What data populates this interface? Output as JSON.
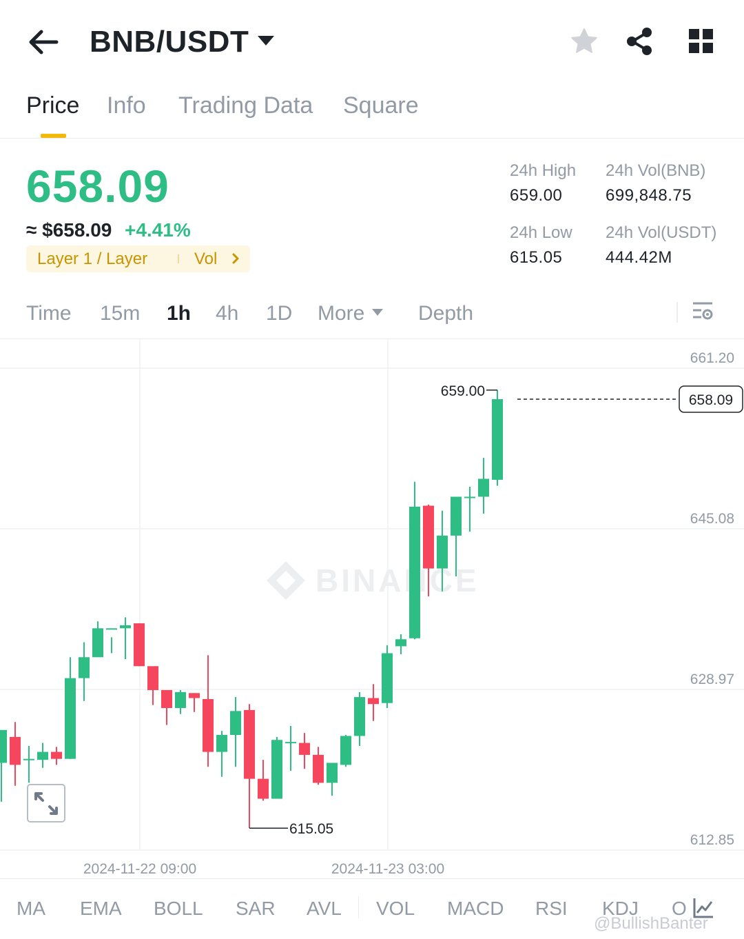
{
  "header": {
    "pair": "BNB/USDT",
    "icons": [
      "back-arrow-icon",
      "caret-down-icon",
      "star-icon",
      "share-icon",
      "grid-icon"
    ]
  },
  "tabs": [
    "Price",
    "Info",
    "Trading Data",
    "Square"
  ],
  "active_tab": "Price",
  "price": {
    "last": "658.09",
    "fiat": "≈ $658.09",
    "change": "+4.41%",
    "tag_category": "Layer 1 / Layer",
    "tag_vol": "Vol"
  },
  "stats": {
    "high_label": "24h High",
    "high_value": "659.00",
    "low_label": "24h Low",
    "low_value": "615.05",
    "vol_base_label": "24h Vol(BNB)",
    "vol_base_value": "699,848.75",
    "vol_quote_label": "24h Vol(USDT)",
    "vol_quote_value": "444.42M"
  },
  "intervals": {
    "time": "Time",
    "m15": "15m",
    "h1": "1h",
    "h4": "4h",
    "d1": "1D",
    "more": "More",
    "depth": "Depth",
    "active": "1h"
  },
  "indicators": [
    "MA",
    "EMA",
    "BOLL",
    "SAR",
    "AVL",
    "VOL",
    "MACD",
    "RSI",
    "KDJ",
    "O"
  ],
  "watermark": "@BullishBanter",
  "colors": {
    "up": "#2ebd85",
    "down": "#f6465d",
    "accent": "#f0b90b",
    "muted": "#929aa5"
  },
  "chart_data": {
    "type": "candlestick",
    "y_ticks": [
      "661.20",
      "645.08",
      "628.97",
      "612.85"
    ],
    "ylim": [
      612.85,
      661.2
    ],
    "x_labels": [
      "2024-11-22 09:00",
      "2024-11-23 03:00"
    ],
    "last_price_label": "658.09",
    "high_label": "659.00",
    "low_label": "615.05",
    "watermark": "BINANCE",
    "candles": [
      {
        "o": 621.6,
        "h": 624.5,
        "l": 617.7,
        "c": 624.9
      },
      {
        "o": 624.2,
        "h": 625.7,
        "l": 619.3,
        "c": 621.4
      },
      {
        "o": 621.9,
        "h": 623.3,
        "l": 619.6,
        "c": 622.0
      },
      {
        "o": 621.9,
        "h": 623.6,
        "l": 621.1,
        "c": 622.7
      },
      {
        "o": 622.7,
        "h": 623.2,
        "l": 621.4,
        "c": 622.0
      },
      {
        "o": 622.0,
        "h": 632.2,
        "l": 622.0,
        "c": 630.1
      },
      {
        "o": 630.1,
        "h": 633.7,
        "l": 627.8,
        "c": 632.2
      },
      {
        "o": 632.2,
        "h": 635.8,
        "l": 632.6,
        "c": 635.1
      },
      {
        "o": 635.1,
        "h": 634.2,
        "l": 632.6,
        "c": 635.1
      },
      {
        "o": 635.1,
        "h": 636.2,
        "l": 632.0,
        "c": 635.4
      },
      {
        "o": 635.6,
        "h": 635.6,
        "l": 631.3,
        "c": 631.3
      },
      {
        "o": 631.3,
        "h": 630.5,
        "l": 627.4,
        "c": 628.9
      },
      {
        "o": 628.9,
        "h": 628.4,
        "l": 625.4,
        "c": 627.1
      },
      {
        "o": 627.1,
        "h": 628.9,
        "l": 626.5,
        "c": 628.7
      },
      {
        "o": 628.6,
        "h": 628.6,
        "l": 626.7,
        "c": 628.1
      },
      {
        "o": 628.0,
        "h": 632.4,
        "l": 621.2,
        "c": 622.7
      },
      {
        "o": 622.7,
        "h": 624.8,
        "l": 620.2,
        "c": 624.4
      },
      {
        "o": 624.4,
        "h": 628.2,
        "l": 621.2,
        "c": 626.8
      },
      {
        "o": 626.9,
        "h": 627.5,
        "l": 615.05,
        "c": 620.0
      },
      {
        "o": 620.0,
        "h": 621.9,
        "l": 617.8,
        "c": 618.0
      },
      {
        "o": 618.0,
        "h": 624.2,
        "l": 618.0,
        "c": 623.9
      },
      {
        "o": 623.7,
        "h": 625.3,
        "l": 620.8,
        "c": 623.7
      },
      {
        "o": 623.6,
        "h": 624.6,
        "l": 621.0,
        "c": 622.4
      },
      {
        "o": 622.4,
        "h": 623.2,
        "l": 619.4,
        "c": 619.6
      },
      {
        "o": 619.6,
        "h": 621.3,
        "l": 618.3,
        "c": 621.6
      },
      {
        "o": 621.4,
        "h": 624.4,
        "l": 621.2,
        "c": 624.3
      },
      {
        "o": 624.3,
        "h": 628.7,
        "l": 623.3,
        "c": 628.2
      },
      {
        "o": 628.1,
        "h": 629.5,
        "l": 625.8,
        "c": 627.5
      },
      {
        "o": 627.6,
        "h": 633.4,
        "l": 627.1,
        "c": 632.6
      },
      {
        "o": 633.3,
        "h": 634.5,
        "l": 632.5,
        "c": 634.0
      },
      {
        "o": 634.1,
        "h": 649.8,
        "l": 634.0,
        "c": 647.3
      },
      {
        "o": 647.4,
        "h": 647.5,
        "l": 638.3,
        "c": 641.1
      },
      {
        "o": 641.1,
        "h": 646.9,
        "l": 638.8,
        "c": 644.4
      },
      {
        "o": 644.4,
        "h": 648.3,
        "l": 640.3,
        "c": 648.3
      },
      {
        "o": 648.3,
        "h": 649.3,
        "l": 644.8,
        "c": 648.3
      },
      {
        "o": 648.3,
        "h": 652.2,
        "l": 646.6,
        "c": 650.1
      },
      {
        "o": 650.0,
        "h": 659.0,
        "l": 649.4,
        "c": 658.09
      }
    ]
  }
}
